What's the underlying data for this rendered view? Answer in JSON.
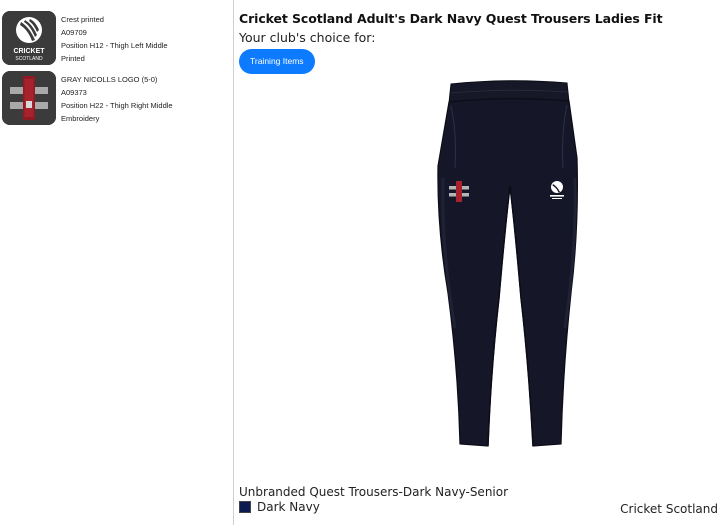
{
  "decorations": [
    {
      "thumb_icon": "cricket-scotland-crest-icon",
      "thumb_text_line1": "CRICKET",
      "thumb_text_line2": "SCOTLAND",
      "name": "Crest printed",
      "code": "A09709",
      "position": "Position H12 - Thigh Left Middle",
      "method": "Printed"
    },
    {
      "thumb_icon": "gray-nicolls-logo-icon",
      "name": "GRAY NICOLLS LOGO (5-0)",
      "code": "A09373",
      "position": "Position H22 - Thigh Right Middle",
      "method": "Embroidery"
    }
  ],
  "product": {
    "title": "Cricket Scotland Adult's Dark Navy Quest Trousers Ladies Fit",
    "subtitle": "Your club's choice for:",
    "category_chip": "Training Items",
    "image_icon": "trousers-product-image",
    "variant_name": "Unbranded Quest Trousers-Dark Navy-Senior",
    "colour": {
      "name": "Dark Navy",
      "swatch": "#0b1a4f"
    }
  },
  "club_name": "Cricket Scotland",
  "colors": {
    "accent": "#0d7bff",
    "trouser_navy": "#151729",
    "thumb_bg": "#3b3b3b"
  }
}
